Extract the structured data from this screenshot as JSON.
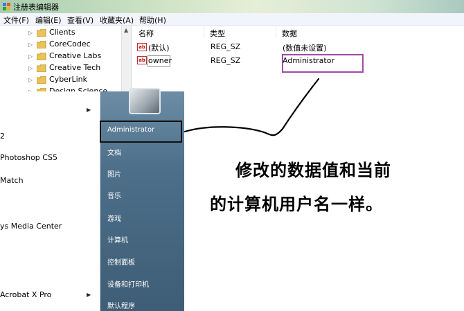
{
  "window": {
    "title": "注册表编辑器"
  },
  "menubar": {
    "items": [
      "文件(F)",
      "编辑(E)",
      "查看(V)",
      "收藏夹(A)",
      "帮助(H)"
    ]
  },
  "tree": {
    "items": [
      {
        "label": "Clients"
      },
      {
        "label": "CoreCodec"
      },
      {
        "label": "Creative Labs"
      },
      {
        "label": "Creative Tech"
      },
      {
        "label": "CyberLink"
      },
      {
        "label": "Design Science"
      }
    ]
  },
  "values": {
    "columns": [
      "名称",
      "类型",
      "数据"
    ],
    "rows": [
      {
        "name": "(默认)",
        "type": "REG_SZ",
        "data": "(数值未设置)"
      },
      {
        "name": "owner",
        "type": "REG_SZ",
        "data": "Administrator"
      }
    ]
  },
  "startmenu": {
    "programs": [
      {
        "label": "",
        "has_arrow": true
      },
      {
        "label": "2",
        "has_arrow": false
      },
      {
        "label": "Photoshop CS5",
        "has_arrow": false
      },
      {
        "label": "Match",
        "has_arrow": false
      },
      {
        "label": "ys Media Center",
        "has_arrow": false
      },
      {
        "label": "Acrobat X Pro",
        "has_arrow": true
      }
    ],
    "links": [
      "Administrator",
      "文档",
      "图片",
      "音乐",
      "游戏",
      "计算机",
      "控制面板",
      "设备和打印机",
      "默认程序"
    ]
  },
  "annotation": {
    "line1": "修改的数据值和当前",
    "line2": "的计算机用户名一样。"
  },
  "colors": {
    "highlight_box": "#a14aa8",
    "startmenu_right": "#4d6f89"
  }
}
